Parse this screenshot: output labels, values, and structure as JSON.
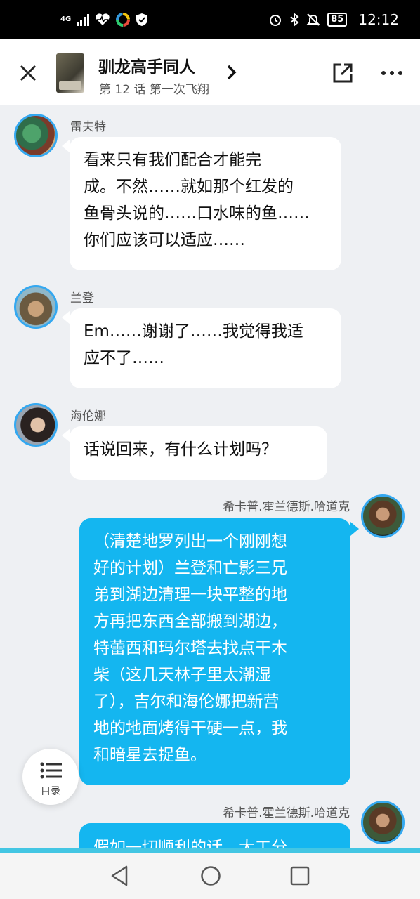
{
  "status_bar": {
    "network": "4G",
    "battery": "85",
    "time": "12:12",
    "icons": [
      "signal-icon",
      "heart-icon",
      "color-wheel-icon",
      "shield-icon",
      "alarm-icon",
      "bluetooth-icon",
      "mute-icon",
      "battery-icon"
    ]
  },
  "header": {
    "title": "驯龙高手同人",
    "subtitle": "第 12 话 第一次飞翔",
    "close_icon": "close-icon",
    "share_icon": "share-icon",
    "more_icon": "more-icon"
  },
  "messages": [
    {
      "side": "left",
      "name": "雷夫特",
      "text": [
        "看来只有我们配合才能完",
        "成。不然……就如那个红发的",
        "鱼骨头说的……口水味的鱼……",
        "你们应该可以适应……"
      ]
    },
    {
      "side": "left",
      "name": "兰登",
      "text": [
        "Em……谢谢了……我觉得我适",
        "应不了……"
      ]
    },
    {
      "side": "left",
      "name": "海伦娜",
      "text": [
        "话说回来，有什么计划吗？"
      ]
    },
    {
      "side": "right",
      "name": "希卡普.霍兰德斯.哈道克",
      "text": [
        "（清楚地罗列出一个刚刚想",
        "好的计划）兰登和亡影三兄",
        "弟到湖边清理一块平整的地",
        "方再把东西全部搬到湖边，",
        "特蕾西和玛尔塔去找点干木",
        "柴（这几天林子里太潮湿",
        "了），吉尔和海伦娜把新营",
        "地的地面烤得干硬一点，我",
        "和暗星去捉鱼。"
      ]
    },
    {
      "side": "right",
      "name": "希卡普.霍兰德斯.哈道克",
      "text": [
        "假如一切顺利的话，太工分"
      ]
    }
  ],
  "toc": {
    "label": "目录"
  },
  "colors": {
    "accent": "#14b6f0",
    "avatar_ring": "#34a8f0",
    "strip": "#43c6e3"
  }
}
